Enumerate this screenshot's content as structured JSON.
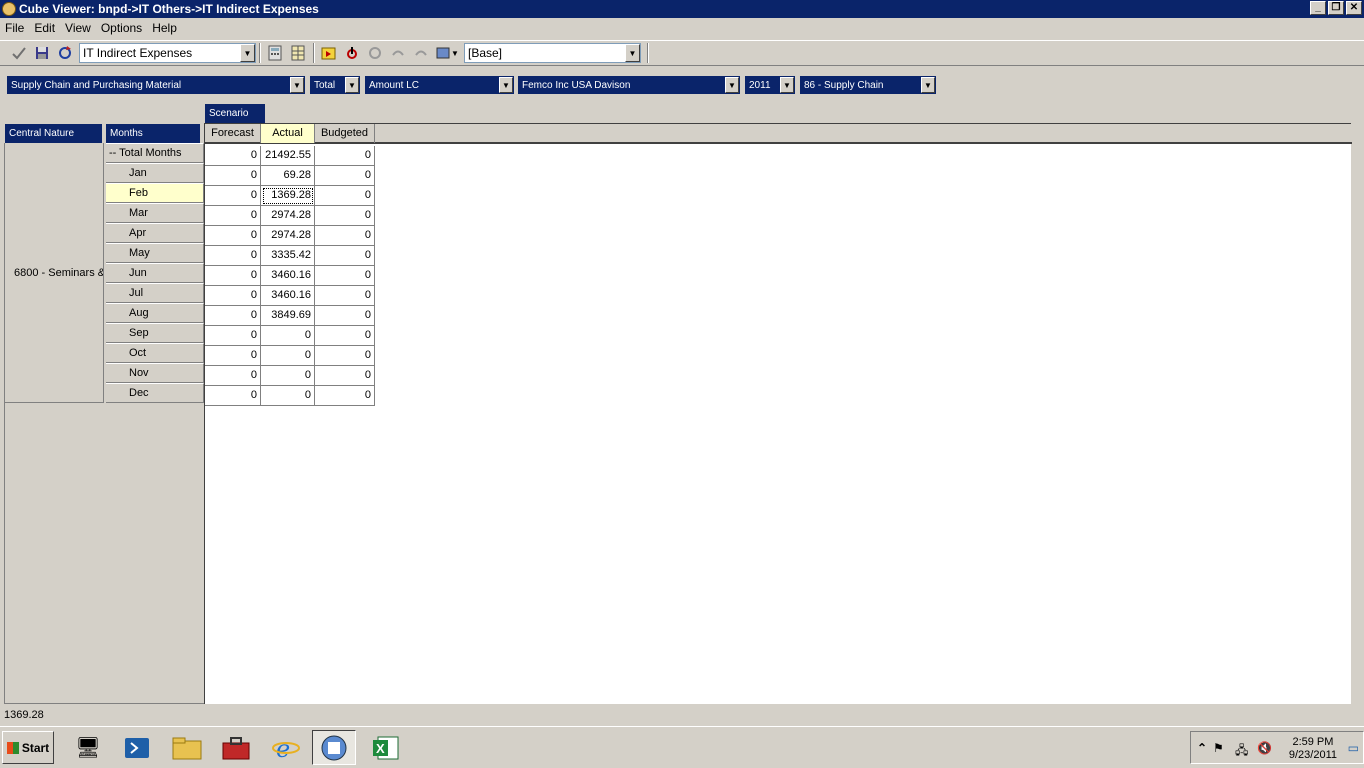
{
  "window": {
    "title": "Cube Viewer: bnpd->IT Others->IT Indirect Expenses"
  },
  "menu": [
    "File",
    "Edit",
    "View",
    "Options",
    "Help"
  ],
  "toolbar": {
    "view_combo": "IT Indirect Expenses",
    "subset_combo": "[Base]"
  },
  "dimensions": [
    "Supply Chain and Purchasing Material",
    "Total",
    "Amount LC",
    "Femco Inc USA Davison",
    "2011",
    "86 -  Supply Chain"
  ],
  "column_dimension": "Scenario",
  "row_dimensions": [
    "Central Nature",
    "Months"
  ],
  "central_nature": "6800 - Seminars &",
  "columns": [
    "Forecast",
    "Actual",
    "Budgeted"
  ],
  "rows": [
    {
      "month": "-- Total Months",
      "values": [
        "0",
        "21492.55",
        "0"
      ]
    },
    {
      "month": "Jan",
      "values": [
        "0",
        "69.28",
        "0"
      ]
    },
    {
      "month": "Feb",
      "values": [
        "0",
        "1369.28",
        "0"
      ]
    },
    {
      "month": "Mar",
      "values": [
        "0",
        "2974.28",
        "0"
      ]
    },
    {
      "month": "Apr",
      "values": [
        "0",
        "2974.28",
        "0"
      ]
    },
    {
      "month": "May",
      "values": [
        "0",
        "3335.42",
        "0"
      ]
    },
    {
      "month": "Jun",
      "values": [
        "0",
        "3460.16",
        "0"
      ]
    },
    {
      "month": "Jul",
      "values": [
        "0",
        "3460.16",
        "0"
      ]
    },
    {
      "month": "Aug",
      "values": [
        "0",
        "3849.69",
        "0"
      ]
    },
    {
      "month": "Sep",
      "values": [
        "0",
        "0",
        "0"
      ]
    },
    {
      "month": "Oct",
      "values": [
        "0",
        "0",
        "0"
      ]
    },
    {
      "month": "Nov",
      "values": [
        "0",
        "0",
        "0"
      ]
    },
    {
      "month": "Dec",
      "values": [
        "0",
        "0",
        "0"
      ]
    }
  ],
  "selected": {
    "row": 2,
    "col": 1
  },
  "status": {
    "value": "1369.28"
  },
  "taskbar": {
    "start": "Start",
    "time": "2:59 PM",
    "date": "9/23/2011"
  },
  "colors": {
    "header_blue": "#0a246a",
    "selected_yellow": "#ffffcc",
    "chrome": "#d4d0c8"
  }
}
